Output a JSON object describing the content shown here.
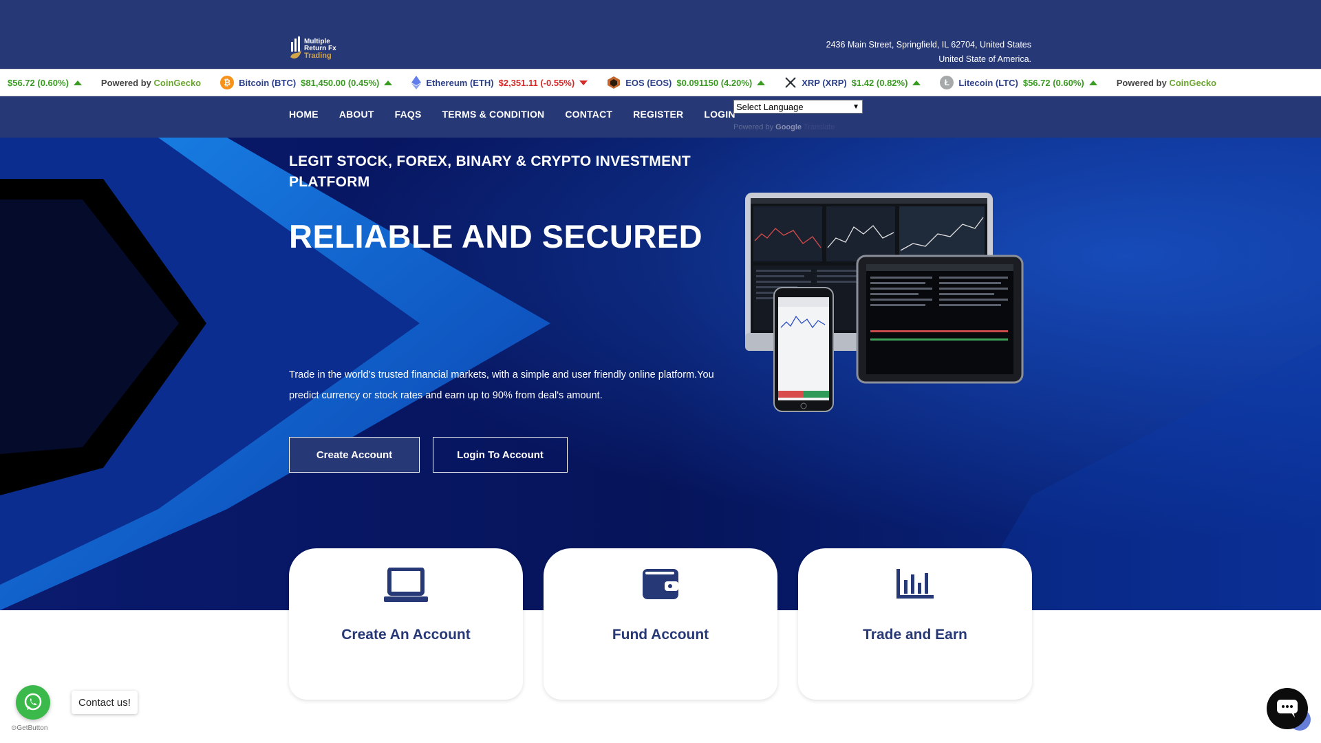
{
  "header": {
    "logo_lines": [
      "Multiple",
      "Return Fx",
      "Trading"
    ],
    "address_line1": "2436 Main Street, Springfield, IL 62704, United States",
    "address_line2": "United State of America."
  },
  "ticker": {
    "lead_price": "$56.72 (0.60%)",
    "powered_prefix": "Powered by",
    "powered_brand": "CoinGecko",
    "items": [
      {
        "name": "Bitcoin (BTC)",
        "price": "$81,450.00 (0.45%)",
        "direction": "up",
        "icon": "bitcoin-icon",
        "color": "#f7931a"
      },
      {
        "name": "Ethereum (ETH)",
        "price": "$2,351.11 (-0.55%)",
        "direction": "down",
        "icon": "ethereum-icon",
        "color": "#627eea"
      },
      {
        "name": "EOS (EOS)",
        "price": "$0.091150 (4.20%)",
        "direction": "up",
        "icon": "eos-icon",
        "color": "#c0662e"
      },
      {
        "name": "XRP (XRP)",
        "price": "$1.42 (0.82%)",
        "direction": "up",
        "icon": "xrp-icon",
        "color": "#23292f"
      },
      {
        "name": "Litecoin (LTC)",
        "price": "$56.72 (0.60%)",
        "direction": "up",
        "icon": "litecoin-icon",
        "color": "#a6a9aa"
      }
    ]
  },
  "nav": {
    "items": [
      "HOME",
      "ABOUT",
      "FAQS",
      "TERMS & CONDITION",
      "CONTACT",
      "REGISTER",
      "LOGIN"
    ],
    "language_select": "Select Language",
    "translate_prefix": "Powered by",
    "translate_google": "Google",
    "translate_word": "Translate"
  },
  "hero": {
    "subtitle": "LEGIT STOCK, FOREX, BINARY & CRYPTO INVESTMENT PLATFORM",
    "title": "RELIABLE AND SECURED",
    "description": "Trade in the world’s trusted financial markets, with a simple and user friendly online platform.You predict currency or stock rates and earn up to 90% from deal's amount.",
    "primary_button": "Create Account",
    "secondary_button": "Login To Account"
  },
  "cards": [
    {
      "label": "Create An Account",
      "icon": "laptop-icon"
    },
    {
      "label": "Fund Account",
      "icon": "wallet-icon"
    },
    {
      "label": "Trade and Earn",
      "icon": "bar-chart-icon"
    }
  ],
  "widgets": {
    "contact_label": "Contact us!",
    "getbutton_label": "GetButton"
  },
  "colors": {
    "brand_navy": "#273877",
    "hero_dark": "#04114f",
    "hero_blue": "#1a7fe0",
    "gold": "#d2a548",
    "up_green": "#3a9b22",
    "down_red": "#d42a2a",
    "whatsapp_green": "#3bb94b"
  }
}
